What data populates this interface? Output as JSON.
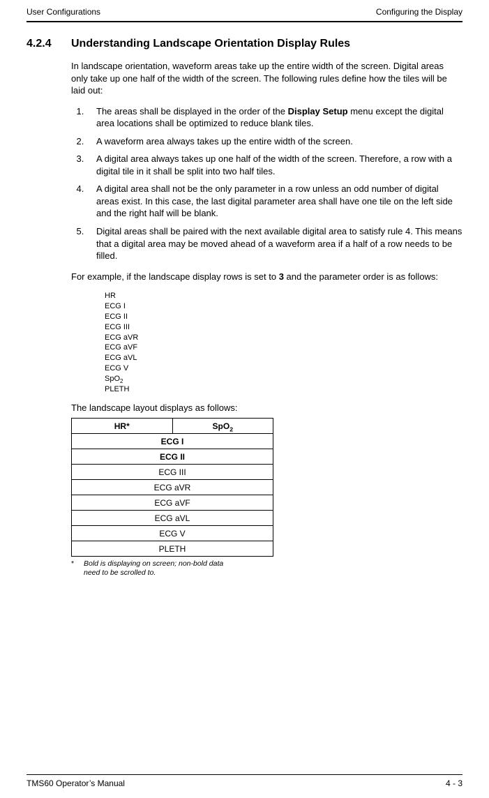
{
  "running_head": {
    "left": "User Configurations",
    "right": "Configuring the Display"
  },
  "section": {
    "number": "4.2.4",
    "title": "Understanding Landscape Orientation Display Rules"
  },
  "intro": "In landscape orientation, waveform areas take up the entire width of the screen. Digital areas only take up one half of the width of the screen. The following rules define how the tiles will be laid out:",
  "rules": [
    {
      "pre": "The areas shall be displayed in the order of the ",
      "bold": "Display Setup",
      "post": " menu except the digital area locations shall be optimized to reduce blank tiles."
    },
    {
      "text": "A waveform area always takes up the entire width of the screen."
    },
    {
      "text": "A digital area always takes up one half of the width of the screen. Therefore, a row with a digital tile in it shall be split into two half tiles."
    },
    {
      "text": "A digital area shall not be the only parameter in a row unless an odd number of digital areas exist. In this case, the last digital parameter area shall have one tile on the left side and the right half will be blank."
    },
    {
      "text": "Digital areas shall be paired with the next available digital area to satisfy rule 4. This means that a digital area may be moved ahead of a waveform area if a half of a row needs to be filled."
    }
  ],
  "example_intro_pre": "For example, if the landscape display rows is set to ",
  "example_intro_bold": "3",
  "example_intro_post": " and the parameter order is as follows:",
  "param_list": [
    "HR",
    "ECG I",
    "ECG II",
    "ECG III",
    "ECG aVR",
    "ECG aVF",
    "ECG aVL",
    "ECG V",
    "SpO₂",
    "PLETH"
  ],
  "layout_caption": "The landscape layout displays as follows:",
  "layout_table": {
    "row1": {
      "left": "HR*",
      "right": "SpO₂"
    },
    "bold_rows": [
      "ECG I",
      "ECG II"
    ],
    "rows": [
      "ECG III",
      "ECG aVR",
      "ECG aVF",
      "ECG aVL",
      "ECG V",
      "PLETH"
    ]
  },
  "footnote": "Bold is displaying on screen; non-bold data need to be scrolled to.",
  "footnote_mark": "*",
  "running_foot": {
    "left": "TMS60 Operator’s Manual",
    "right": "4 - 3"
  }
}
